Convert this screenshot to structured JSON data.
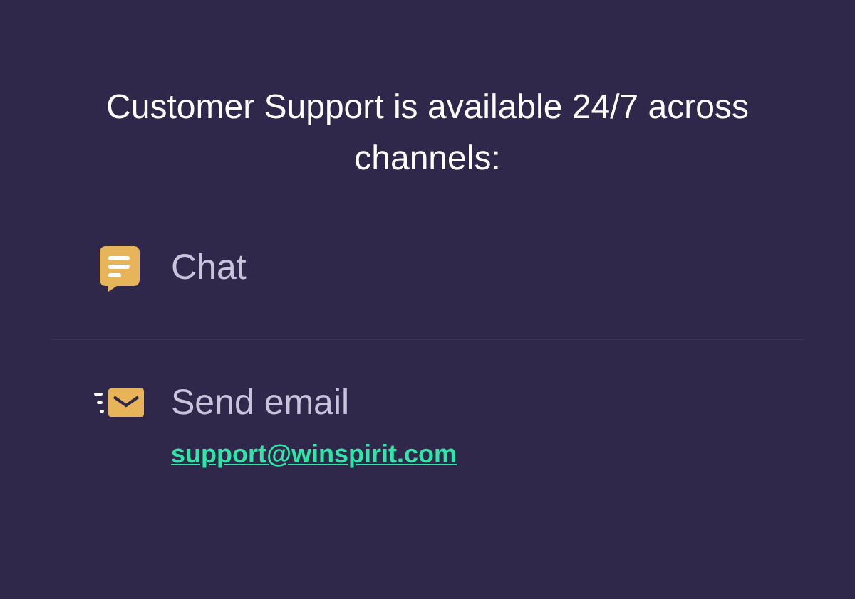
{
  "heading": "Customer Support is available 24/7 across channels:",
  "channels": [
    {
      "kind": "chat",
      "label": "Chat"
    },
    {
      "kind": "email",
      "label": "Send email",
      "link": "support@winspirit.com"
    }
  ]
}
